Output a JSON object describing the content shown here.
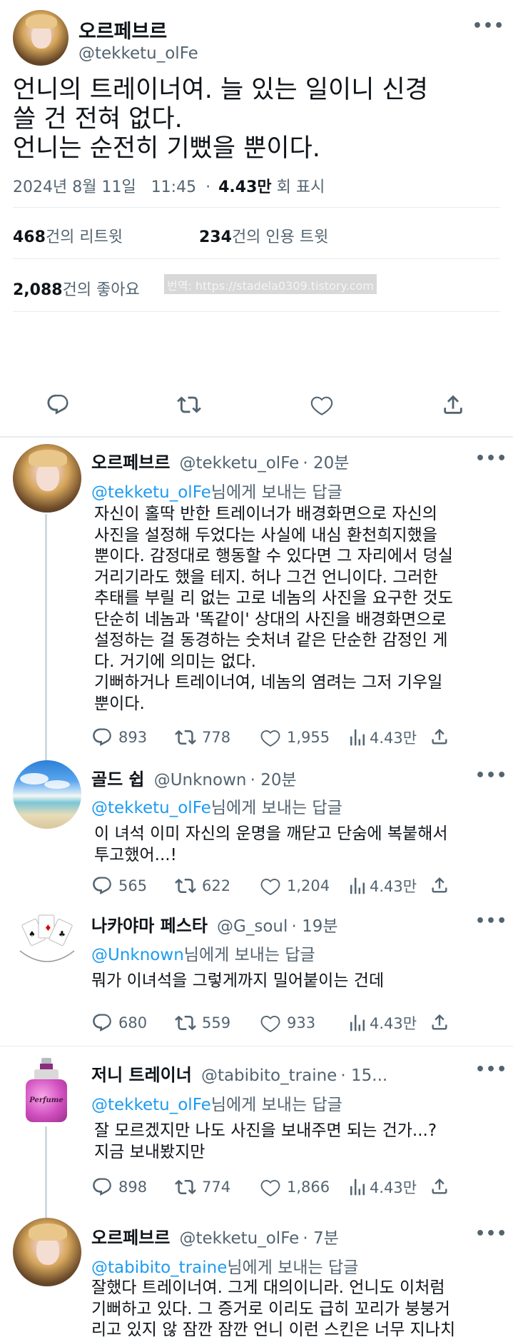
{
  "main_tweet": {
    "display_name": "오르페브르",
    "handle": "@tekketu_olFe",
    "text_lines": [
      "언니의 트레이너여. 늘 있는 일이니 신경",
      "쓸 건 전혀 없다.",
      "언니는 순전히 기뻤을 뿐이다."
    ],
    "date": "2024년 8월 11일",
    "time": "11:45",
    "separator": "·",
    "views": "4.43만",
    "views_label": "회 표시",
    "retweets_count": "468",
    "retweets_label": "건의 리트윗",
    "quotes_count": "234",
    "quotes_label": "건의 인용 트윗",
    "likes_count": "2,088",
    "likes_label": "건의 좋아요",
    "watermark": "번역: https://stadela0309.tistory.com"
  },
  "replies": [
    {
      "display_name": "오르페브르",
      "handle": "@tekketu_olFe",
      "time": "· 20분",
      "reply_to_handle": "@tekketu_olFe",
      "reply_to_suffix": "님에게 보내는 답글",
      "body": "자신이 홀딱 반한 트레이너가 배경화면으로 자신의\n사진을 설정해 두었다는 사실에 내심 환천희지했을\n뿐이다. 감정대로 행동할 수 있다면 그 자리에서 덩실\n거리기라도 했을 테지. 허나 그건 언니이다. 그러한\n추태를 부릴 리 없는 고로 네놈의 사진을 요구한 것도\n단순히 네놈과 '똑같이' 상대의 사진을 배경화면으로\n설정하는 걸 동경하는 숫처녀 같은 단순한 감정인 게\n다. 거기에 의미는 없다.\n기뻐하거나 트레이너여, 네놈의 염려는 그저 기우일\n뿐이다.",
      "comments": "893",
      "retweets": "778",
      "likes": "1,955",
      "views": "4.43만"
    },
    {
      "display_name": "골드 쉽",
      "handle": "@Unknown",
      "time": "· 20분",
      "reply_to_handle": "@tekketu_olFe",
      "reply_to_suffix": "님에게 보내는 답글",
      "body": "이 녀석 이미 자신의 운명을 깨닫고 단숨에 복붙해서\n투고했어...!",
      "comments": "565",
      "retweets": "622",
      "likes": "1,204",
      "views": "4.43만"
    },
    {
      "display_name": "나카야마 페스타",
      "handle": "@G_soul",
      "time": "· 19분",
      "reply_to_handle": "@Unknown",
      "reply_to_suffix": "님에게 보내는 답글",
      "body": "뭐가 이녀석을 그렇게까지 밀어붙이는 건데",
      "comments": "680",
      "retweets": "559",
      "likes": "933",
      "views": "4.43만"
    },
    {
      "display_name": "저니 트레이너",
      "handle": "@tabibito_traine",
      "time": "· 15...",
      "reply_to_handle": "@tekketu_olFe",
      "reply_to_suffix": "님에게 보내는 답글",
      "body": "잘 모르겠지만 나도 사진을 보내주면 되는 건가...?\n지금 보내봤지만",
      "comments": "898",
      "retweets": "774",
      "likes": "1,866",
      "views": "4.43만",
      "avatar_text": "Perfume"
    },
    {
      "display_name": "오르페브르",
      "handle": "@tekketu_olFe",
      "time": "· 7분",
      "reply_to_handle": "@tabibito_traine",
      "reply_to_suffix": "님에게 보내는 답글",
      "body": "잘했다 트레이너여. 그게 대의이니라. 언니도 이처럼\n기뻐하고 있다. 그 증거로 이리도 급히 꼬리가 붕붕거\n리고 있지 않 잠깐 잠깐 언니 이런 스킨은 너무 지나치"
    }
  ],
  "icons": {
    "more": "more-dots-icon",
    "comment": "comment-icon",
    "retweet": "retweet-icon",
    "like": "heart-icon",
    "views": "views-chart-icon",
    "share": "share-icon"
  },
  "colors": {
    "link": "#1d9bf0",
    "muted": "#536471",
    "text": "#0f1419",
    "divider": "#e6ecf0"
  }
}
